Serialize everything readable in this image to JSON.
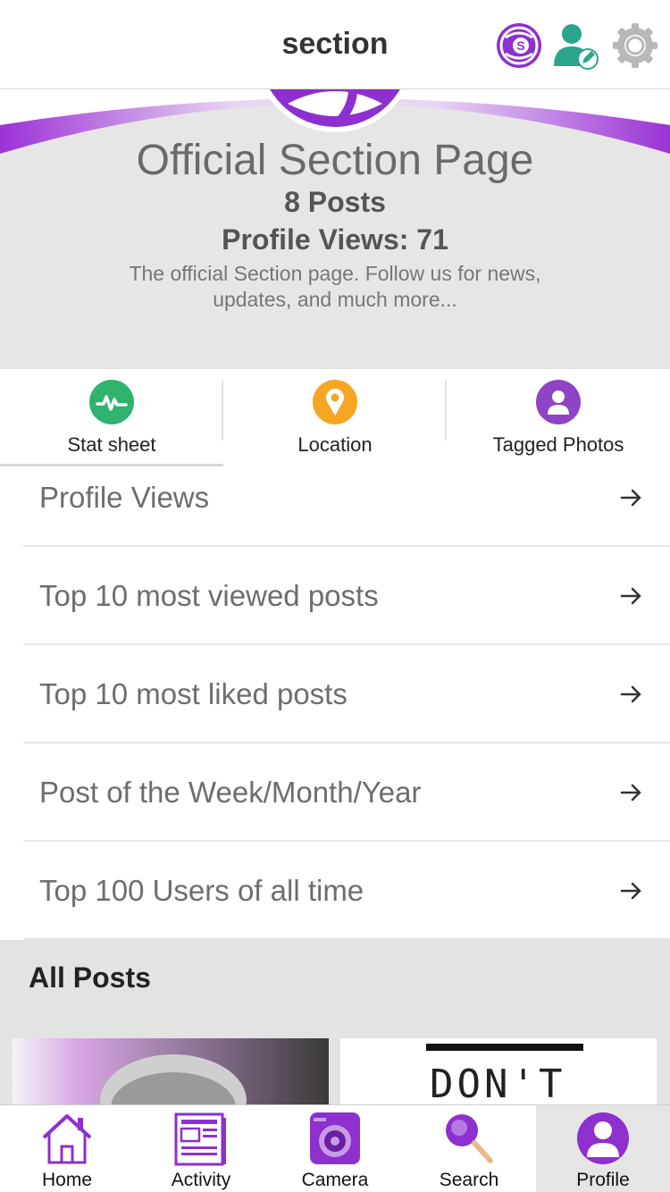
{
  "header": {
    "title": "section",
    "icons": [
      "section-logo-icon",
      "edit-profile-icon",
      "gear-icon"
    ]
  },
  "profile": {
    "name": "Official Section Page",
    "posts": "8 Posts",
    "views": "Profile Views: 71",
    "bio": "The official Section page. Follow us for news, updates, and much more..."
  },
  "tabs": [
    {
      "label": "Stat sheet",
      "icon": "stats-icon",
      "color": "#2fb36e"
    },
    {
      "label": "Location",
      "icon": "location-pin-icon",
      "color": "#f5a623"
    },
    {
      "label": "Tagged Photos",
      "icon": "person-icon",
      "color": "#8e44c4"
    }
  ],
  "stats": [
    {
      "label": "Profile Views"
    },
    {
      "label": "Top 10 most viewed posts"
    },
    {
      "label": "Top 10 most liked posts"
    },
    {
      "label": "Post of the Week/Month/Year"
    },
    {
      "label": "Top 100 Users of all time"
    }
  ],
  "all_posts": {
    "heading": "All Posts",
    "second_post_text": "DON'T"
  },
  "bottom_nav": [
    {
      "label": "Home",
      "icon": "home-icon"
    },
    {
      "label": "Activity",
      "icon": "activity-icon"
    },
    {
      "label": "Camera",
      "icon": "camera-icon"
    },
    {
      "label": "Search",
      "icon": "search-icon"
    },
    {
      "label": "Profile",
      "icon": "profile-icon",
      "active": true
    }
  ],
  "colors": {
    "brand": "#8e2fd0",
    "accent_green": "#2fb36e",
    "accent_orange": "#f5a623"
  }
}
